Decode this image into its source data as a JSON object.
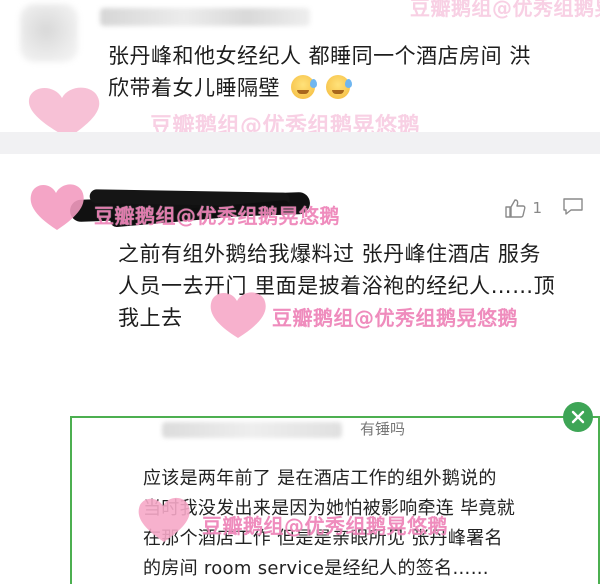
{
  "top_comment": {
    "line1": "张丹峰和他女经纪人 都睡同一个酒店房间 洪",
    "line2": "欣带着女儿睡隔壁",
    "emoji": [
      "cold-sweat-emoji",
      "cold-sweat-emoji"
    ],
    "watermark_faded": "豆瓣鹅组@优秀组鹅晃悠鹅"
  },
  "reply_comment": {
    "watermark": "豆瓣鹅组@优秀组鹅晃悠鹅",
    "like_count": "1",
    "line1": "之前有组外鹅给我爆料过 张丹峰住酒店 服务",
    "line2": "人员一去开门 里面是披着浴袍的经纪人……顶",
    "line3": "我上去",
    "watermark2": "豆瓣鹅组@优秀组鹅晃悠鹅"
  },
  "inset": {
    "caption": "有锤吗",
    "line1": "应该是两年前了 是在酒店工作的组外鹅说的",
    "line2": "当时我没发出来是因为她怕被影响牵连 毕竟就",
    "line3": "在那个酒店工作 但是是亲眼所见 张丹峰署名",
    "line4": "的房间 room service是经纪人的签名……",
    "watermark": "豆瓣鹅组@优秀组鹅晃悠鹅"
  },
  "colors": {
    "accent_green": "#4caf50",
    "watermark_pink": "#ec78b2",
    "heart_pink": "#f6a8c8"
  }
}
